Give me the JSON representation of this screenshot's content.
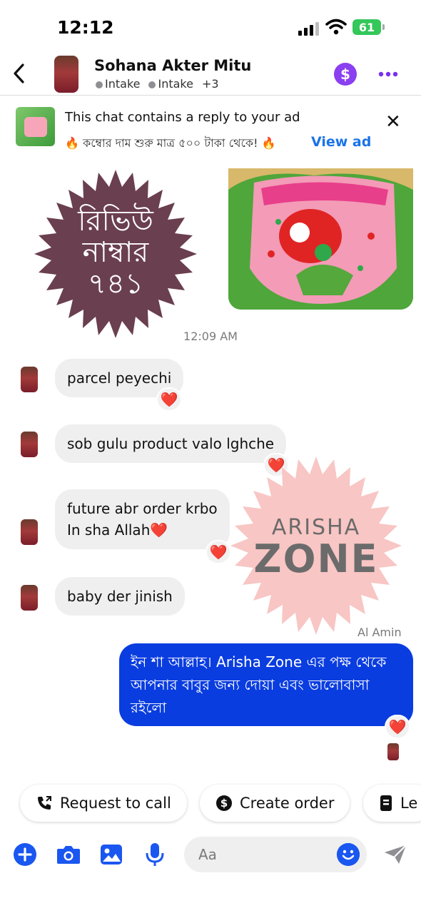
{
  "status_bar": {
    "time": "12:12",
    "battery": "61"
  },
  "header": {
    "name": "Sohana Akter Mitu",
    "labels": [
      "Intake",
      "Intake"
    ],
    "extra_labels": "+3",
    "payment_symbol": "$"
  },
  "ad_banner": {
    "title": "This chat contains a reply to your ad",
    "subtitle": "🔥 কম্বোর দাম শুরু মাত্র ৫০০ টাকা থেকে! 🔥",
    "view_ad": "View ad"
  },
  "review_badge": {
    "line1": "রিভিউ",
    "line2": "নাম্বার",
    "line3": "৭৪১"
  },
  "timestamp": "12:09 AM",
  "messages_in": [
    {
      "text": "parcel peyechi",
      "reaction": "❤️"
    },
    {
      "text": "sob gulu product valo lghche",
      "reaction": "❤️"
    },
    {
      "text_line1": "future abr order krbo",
      "text_line2": "In sha Allah❤️",
      "reaction": "❤️"
    },
    {
      "text": "baby der jinish"
    }
  ],
  "watermark": {
    "line1": "ARISHA",
    "line2": "ZONE"
  },
  "outgoing": {
    "sender": "Al Amin",
    "text": "ইন শা আল্লাহ। Arisha Zone এর পক্ষ থেকে আপনার বাবুর জন্য দোয়া এবং ভালোবাসা রইলো",
    "reaction": "❤️"
  },
  "quick_actions": [
    {
      "label": "Request to call",
      "icon": "phone-icon"
    },
    {
      "label": "Create order",
      "icon": "dollar-circle-icon"
    },
    {
      "label": "Le",
      "icon": "document-icon"
    }
  ],
  "composer": {
    "placeholder": "Aa"
  },
  "colors": {
    "accent": "#0a3de0",
    "purple": "#8a3ff0",
    "link": "#1a73e8"
  }
}
